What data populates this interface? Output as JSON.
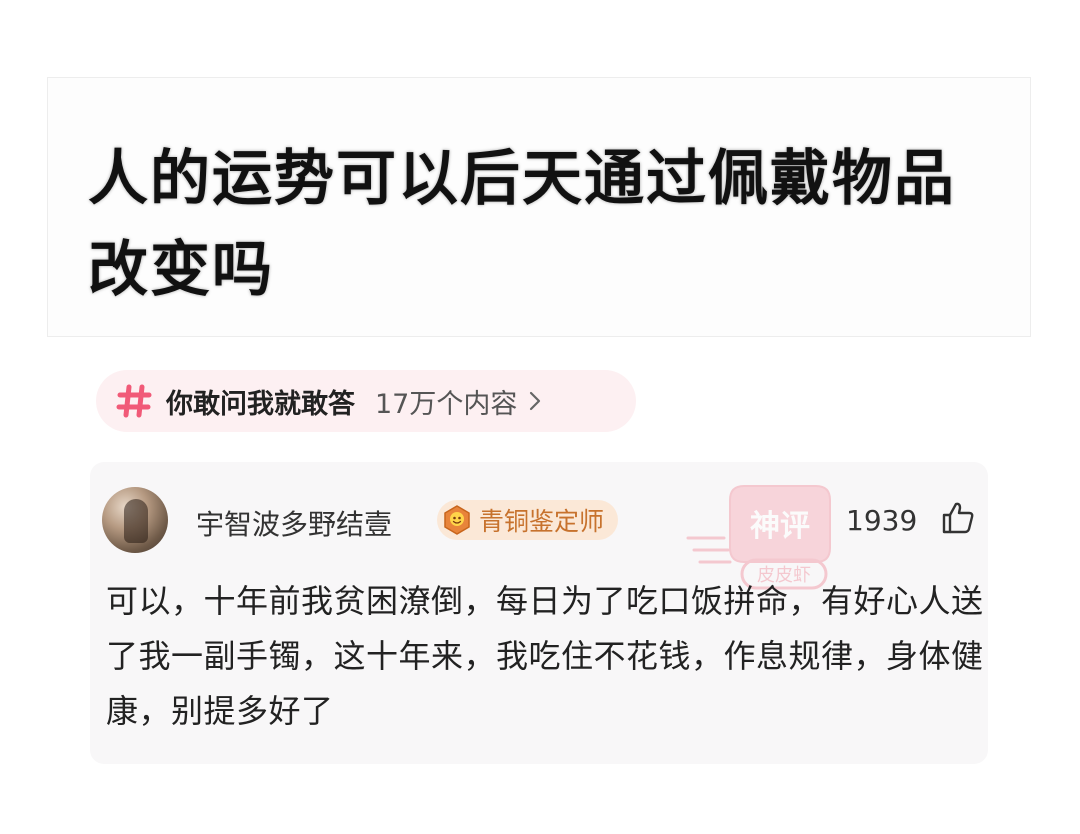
{
  "question": {
    "title": "人的运势可以后天通过佩戴物品改变吗"
  },
  "topic": {
    "icon": "hash-icon",
    "name": "你敢问我就敢答",
    "count": "17万个内容",
    "accent": "#f15a78"
  },
  "answer": {
    "username": "宇智波多野结壹",
    "badge_label": "青铜鉴定师",
    "badge_color": "#e8843a",
    "stamp_text_top": "神评",
    "stamp_text_bottom": "皮皮虾",
    "like_count": "1939",
    "text": "可以，十年前我贫困潦倒，每日为了吃口饭拼命，有好心人送了我一副手镯，这十年来，我吃住不花钱，作息规律，身体健康，别提多好了"
  }
}
